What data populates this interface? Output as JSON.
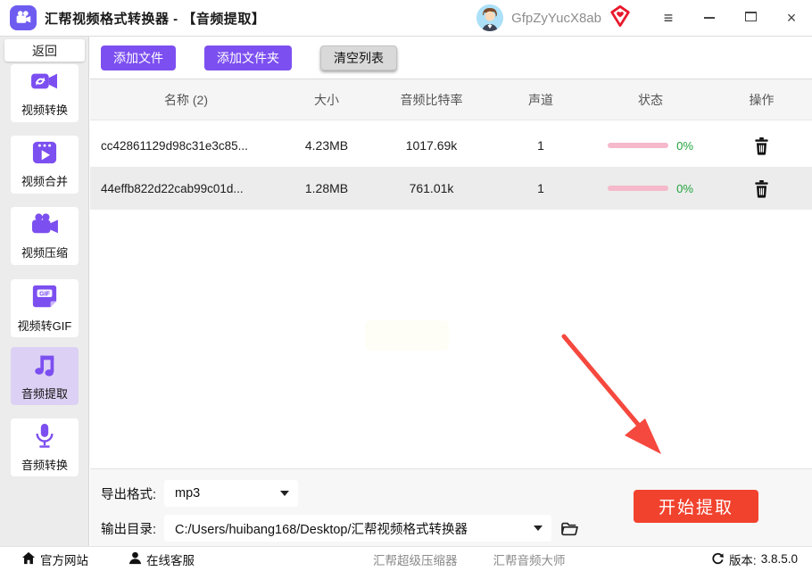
{
  "titlebar": {
    "app_title": "汇帮视频格式转换器 - 【音频提取】",
    "username": "GfpZyYucX8ab"
  },
  "sidebar": {
    "back_label": "返回",
    "items": [
      {
        "label": "视频转换",
        "icon": "video-convert-icon",
        "selected": false
      },
      {
        "label": "视频合并",
        "icon": "video-merge-icon",
        "selected": false
      },
      {
        "label": "视频压缩",
        "icon": "video-compress-icon",
        "selected": false
      },
      {
        "label": "视频转GIF",
        "icon": "video-to-gif-icon",
        "selected": false
      },
      {
        "label": "音频提取",
        "icon": "audio-extract-icon",
        "selected": true
      },
      {
        "label": "音频转换",
        "icon": "audio-convert-icon",
        "selected": false
      }
    ]
  },
  "toolbar": {
    "add_file": "添加文件",
    "add_folder": "添加文件夹",
    "clear_list": "清空列表"
  },
  "table": {
    "headers": [
      "名称 (2)",
      "大小",
      "音频比特率",
      "声道",
      "状态",
      "操作"
    ],
    "rows": [
      {
        "name": "cc42861129d98c31e3c85...",
        "size": "4.23MB",
        "bitrate": "1017.69k",
        "channels": "1",
        "progress_pct": "0%"
      },
      {
        "name": "44effb822d22cab99c01d...",
        "size": "1.28MB",
        "bitrate": "761.01k",
        "channels": "1",
        "progress_pct": "0%"
      }
    ]
  },
  "output": {
    "format_label": "导出格式:",
    "format_value": "mp3",
    "dir_label": "输出目录:",
    "dir_value": "C:/Users/huibang168/Desktop/汇帮视频格式转换器",
    "start_button": "开始提取"
  },
  "footer": {
    "official_site": "官方网站",
    "online_service": "在线客服",
    "link_compressor": "汇帮超级压缩器",
    "link_audio_master": "汇帮音频大师",
    "version_label": "版本:",
    "version_value": "3.8.5.0"
  },
  "colors": {
    "accent_purple": "#7c4ff0",
    "accent_red": "#f1422e",
    "progress_pink": "#f5b9cb",
    "percent_green": "#1ea43b",
    "selected_item_bg": "#dcd1f4"
  }
}
